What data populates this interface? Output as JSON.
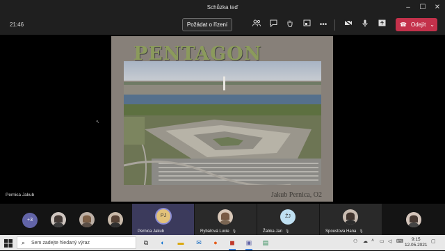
{
  "window": {
    "title": "Schůzka teď"
  },
  "toolbar": {
    "elapsed": "21:46",
    "control_label": "Požádat o řízení",
    "leave_label": "Odejít"
  },
  "slide": {
    "title": "PENTAGON",
    "author": "Jakub Pernica, O2"
  },
  "stage": {
    "presenter_name": "Pernica Jakub"
  },
  "gallery": {
    "overflow_count": "+3",
    "tiles": [
      {
        "name": "Pernica Jakub",
        "initials": "PJ"
      },
      {
        "name": "Rybářová Lucie"
      },
      {
        "name": "Žabka Jan",
        "initials": "ŽJ"
      },
      {
        "name": "Spoustova Hana"
      }
    ]
  },
  "taskbar": {
    "search_placeholder": "Sem zadejte hledaný výraz",
    "time": "9:15",
    "date": "12.05.2021"
  },
  "colors": {
    "accent": "#6264a7",
    "leave": "#c4314b",
    "slide_title": "#8b9a5c"
  },
  "icons": [
    "people-icon",
    "chat-icon",
    "raise-hand-icon",
    "rooms-icon",
    "share-screen-icon",
    "more-icon",
    "camera-off-icon",
    "mic-icon",
    "share-tray-icon",
    "phone-icon"
  ]
}
